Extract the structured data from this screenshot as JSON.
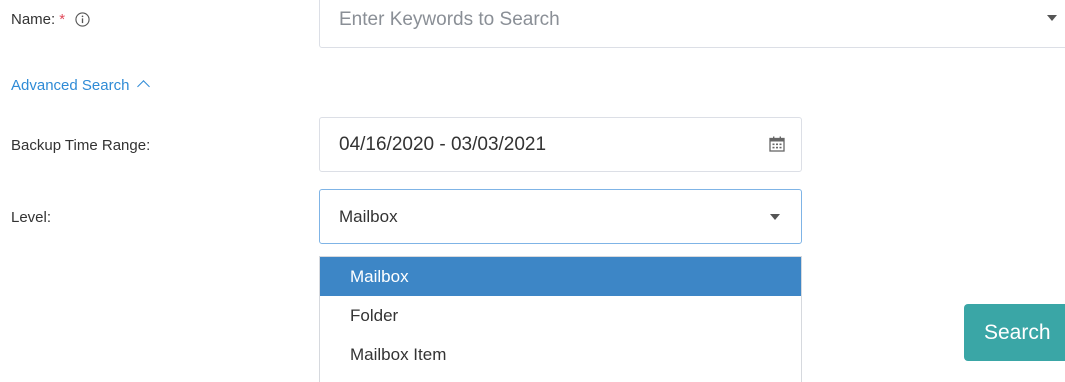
{
  "form": {
    "name_label": "Name:",
    "name_required_mark": "*",
    "name_placeholder": "Enter Keywords to Search",
    "advanced_search_label": "Advanced Search",
    "backup_time_label": "Backup Time Range:",
    "backup_time_value": "04/16/2020 - 03/03/2021",
    "level_label": "Level:",
    "level_value": "Mailbox",
    "level_options": [
      "Mailbox",
      "Folder",
      "Mailbox Item"
    ],
    "search_button_label": "Search"
  },
  "colors": {
    "link": "#2f8bd6",
    "required": "#e0495a",
    "selected_option_bg": "#3d86c6",
    "button_bg": "#3aa6a6"
  },
  "icons": {
    "info": "info-icon",
    "calendar": "calendar-icon",
    "caret": "caret-down-icon",
    "chevron": "chevron-up-icon"
  }
}
